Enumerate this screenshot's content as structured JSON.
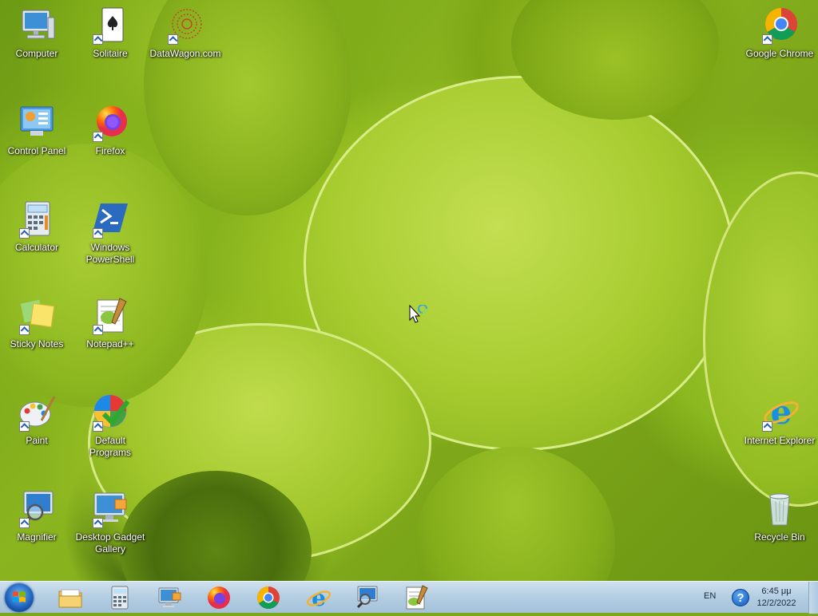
{
  "desktop": {
    "icons": [
      {
        "id": "computer",
        "label": "Computer"
      },
      {
        "id": "solitaire",
        "label": "Solitaire"
      },
      {
        "id": "datawagon",
        "label": "DataWagon.com"
      },
      {
        "id": "google-chrome",
        "label": "Google Chrome"
      },
      {
        "id": "control-panel",
        "label": "Control Panel"
      },
      {
        "id": "firefox",
        "label": "Firefox"
      },
      {
        "id": "calculator",
        "label": "Calculator"
      },
      {
        "id": "windows-powershell",
        "label": "Windows PowerShell"
      },
      {
        "id": "sticky-notes",
        "label": "Sticky Notes"
      },
      {
        "id": "notepad-plus-plus",
        "label": "Notepad++"
      },
      {
        "id": "paint",
        "label": "Paint"
      },
      {
        "id": "default-programs",
        "label": "Default Programs"
      },
      {
        "id": "internet-explorer",
        "label": "Internet Explorer"
      },
      {
        "id": "magnifier",
        "label": "Magnifier"
      },
      {
        "id": "desktop-gadget-gallery",
        "label": "Desktop Gadget Gallery"
      },
      {
        "id": "recycle-bin",
        "label": "Recycle Bin"
      }
    ]
  },
  "taskbar": {
    "start_icon": "windows-start-orb",
    "pinned": [
      "file-explorer-icon",
      "calculator-icon",
      "remote-desktop-icon",
      "firefox-icon",
      "chrome-icon",
      "internet-explorer-icon",
      "magnifier-icon",
      "notepad-plus-plus-icon"
    ],
    "language": "EN",
    "help_glyph": "?",
    "time": "6:45 μμ",
    "date": "12/2/2022"
  },
  "colors": {
    "taskbar_top": "#cfe0ee",
    "taskbar_bottom": "#a5c2da",
    "wallpaper_green": "#9cc424"
  }
}
